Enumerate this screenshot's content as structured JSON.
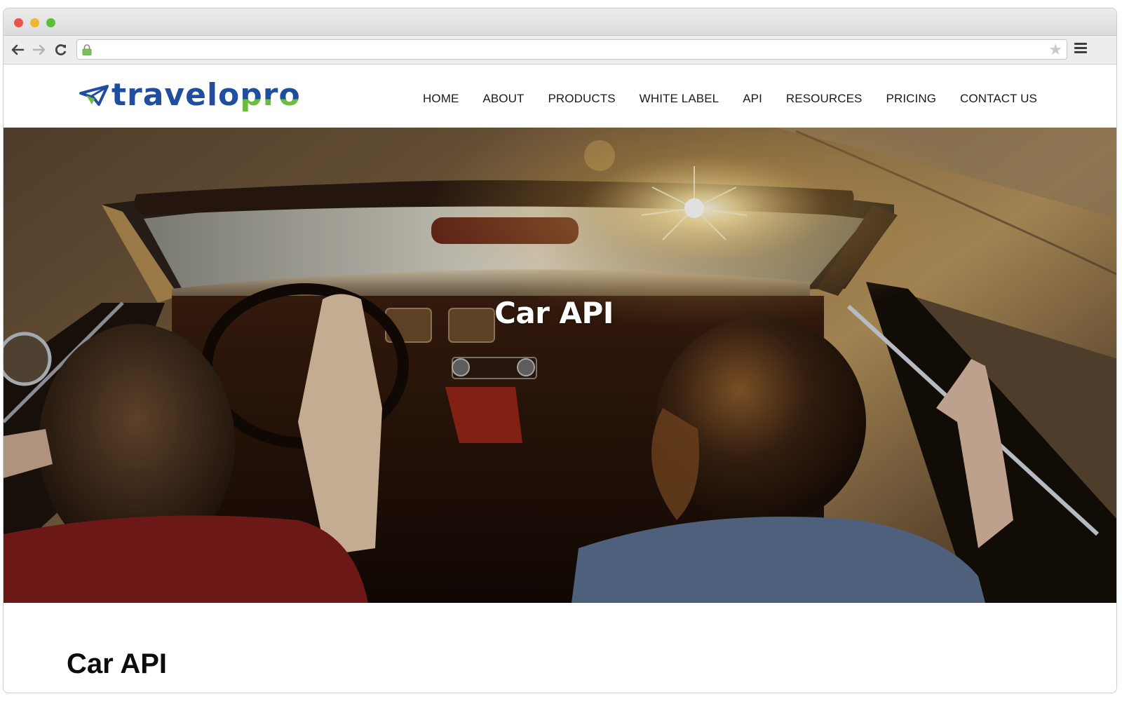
{
  "browser": {
    "address_bar": {
      "url": "",
      "secure": true
    },
    "icons": {
      "back": "arrow-left-icon",
      "forward": "arrow-right-icon",
      "reload": "reload-icon",
      "lock": "lock-icon",
      "bookmark": "star-icon",
      "menu": "hamburger-menu-icon"
    },
    "glyphs": {
      "back": "←",
      "forward": "→",
      "reload": "↻",
      "star": "★"
    }
  },
  "site": {
    "logo": {
      "prefix": "travelo",
      "suffix": "pro",
      "colors": {
        "primary": "#1f4e9f",
        "accent": "#6cbd3b"
      }
    },
    "nav": [
      {
        "label": "HOME"
      },
      {
        "label": "ABOUT"
      },
      {
        "label": "PRODUCTS"
      },
      {
        "label": "WHITE LABEL"
      },
      {
        "label": "API"
      },
      {
        "label": "RESOURCES"
      },
      {
        "label": "PRICING"
      },
      {
        "label": "CONTACT US"
      }
    ]
  },
  "hero": {
    "title": "Car API",
    "image_description": "Two people riding in a convertible car on a sunlit desert road"
  },
  "content": {
    "heading": "Car API"
  }
}
